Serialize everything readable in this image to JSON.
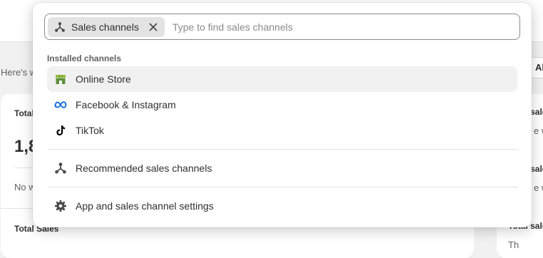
{
  "background": {
    "intro_text": "Here's w",
    "card_left": {
      "label": "Total",
      "value": "1,8",
      "note": "No w"
    },
    "bottom_label": "Total Sales",
    "filter_button": "Al",
    "right_cards": [
      {
        "label": "Total sale",
        "note": "e w"
      },
      {
        "label": "Total sale",
        "note": "e w"
      },
      {
        "label": "Total sale",
        "note": "Th"
      }
    ]
  },
  "search": {
    "tag_label": "Sales channels",
    "tag_icon": "sales-channels-icon",
    "close_icon": "close-icon",
    "placeholder": "Type to find sales channels",
    "value": ""
  },
  "installed": {
    "heading": "Installed channels",
    "items": [
      {
        "label": "Online Store",
        "icon": "online-store-icon",
        "highlighted": true
      },
      {
        "label": "Facebook & Instagram",
        "icon": "meta-icon",
        "highlighted": false
      },
      {
        "label": "TikTok",
        "icon": "tiktok-icon",
        "highlighted": false
      }
    ]
  },
  "recommended": {
    "label": "Recommended sales channels",
    "icon": "sales-channels-icon"
  },
  "settings": {
    "label": "App and sales channel settings",
    "icon": "gear-icon"
  },
  "colors": {
    "online_store_green": "#5e8e3e",
    "meta_blue": "#0668e1",
    "tiktok_black": "#000000",
    "highlight_bg": "#f1f1f1",
    "tag_bg": "#e3e3e3"
  }
}
